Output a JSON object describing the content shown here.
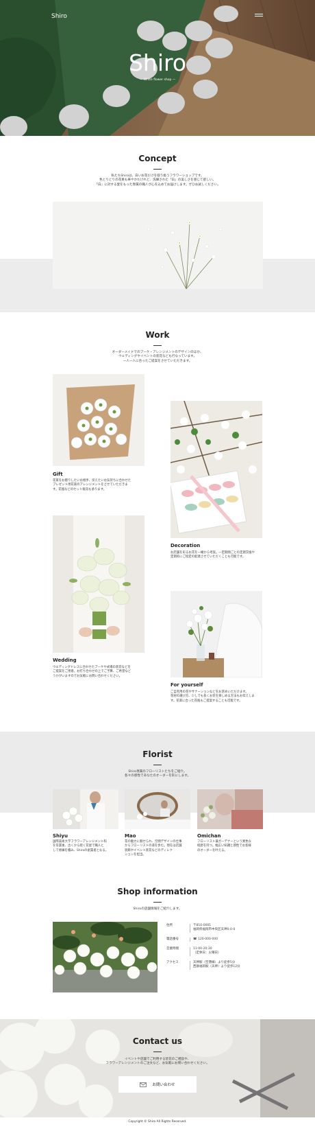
{
  "header": {
    "logo": "Shiro",
    "title": "Shiro",
    "subtitle": "— White flower shop —"
  },
  "concept": {
    "title": "Concept",
    "lead": [
      "私たちShiroは、白いお花だけを取り扱うフラワーショップです。",
      "色とりどりの花束も華やかだけれど、洗練された「白」の美しさを感じて欲しい。",
      "「白」に対する愛をもった専属の職人が心を込めてお届けします。ぜひお試しください。"
    ]
  },
  "work": {
    "title": "Work",
    "lead": [
      "オーダーメイドでのブーケ・アレンジメントのデザインのほか、",
      "ウェディングやイベントの装花なども行なっています。",
      "一人一人に合ったご提案をさせていただきます。"
    ],
    "items": [
      {
        "title": "Gift",
        "desc": [
          "花束をお贈りしたいお相手、伝えたいお気持ちに合わせた",
          "プレゼント用花束のアレンジメントをさせていただきま",
          "す。花瓶などのセット販売も承ります。"
        ]
      },
      {
        "title": "Decoration",
        "desc": [
          "お店舗を彩るお花を一緒から考案。一定期間ごとの定期交換や",
          "定期的にご指定の配達させていただくことも可能です。"
        ]
      },
      {
        "title": "Wedding",
        "desc": [
          "ウエディングドレスに合わせたブーケや式場の装花などを",
          "ご提案をご用意。お打ち合わせの上でご予算、ご希望など",
          "うかがいますのでお気軽にお問い合わせください。"
        ]
      },
      {
        "title": "For yourself",
        "desc": [
          "ご自宅用の花やサナーションなどをお求めいただけます。",
          "花材の選び方、少しでも長くお花を楽しめる方法もお伝えしま",
          "す。花束に合った花瓶もご提案することも可能です。"
        ]
      }
    ]
  },
  "florist": {
    "title": "Florist",
    "lead": [
      "Shiro専属のフローリストたちをご紹介。",
      "各々の感性であなたのオーダーを形にします。"
    ],
    "people": [
      {
        "name": "Shiyu",
        "desc": [
          "国際美術大学フラワーアレンジメント科",
          "を卒業後、古くから続く花屋で職人と",
          "して修練を積み、Shiroの創業者となる。"
        ]
      },
      {
        "name": "Mao",
        "desc": [
          "花の魅力に魅せられ、空間デザインの仕事",
          "からフローリストの道を歩む。現在は店舗",
          "装飾やイベント装花などのディレク",
          "ションを担当。"
        ]
      },
      {
        "name": "Omichan",
        "desc": [
          "フローリスト兼ガーデナーという異色な",
          "経歴を持つ。幅広い知識と感性でお客様",
          "のオーダーを叶える。"
        ]
      }
    ]
  },
  "shop": {
    "title": "Shop information",
    "lead": "Shiroの店舗情報をご紹介します。",
    "rows": [
      {
        "key": "住所",
        "value": [
          "〒810-0001",
          "福岡県福岡市中央区天神0-0-0"
        ]
      },
      {
        "key": "電話番号",
        "value": [
          "☎ 120-000-000"
        ]
      },
      {
        "key": "営業時間",
        "value": [
          "11:00-20:30",
          "（定休日：火曜日）"
        ]
      },
      {
        "key": "アクセス",
        "value": [
          "天神駅（空港線）より徒歩5分",
          "西鉄福岡駅（天神）より徒歩12分"
        ]
      }
    ]
  },
  "contact": {
    "title": "Contact us",
    "lead": [
      "イベントや店舗でご利用する装花のご相談や、",
      "フラワーアレンジメントのご注文など、お気軽にお問い合わせください。"
    ],
    "button": "お問い合わせ"
  },
  "footer": "Copyright © Shiro All Rights Reserved."
}
